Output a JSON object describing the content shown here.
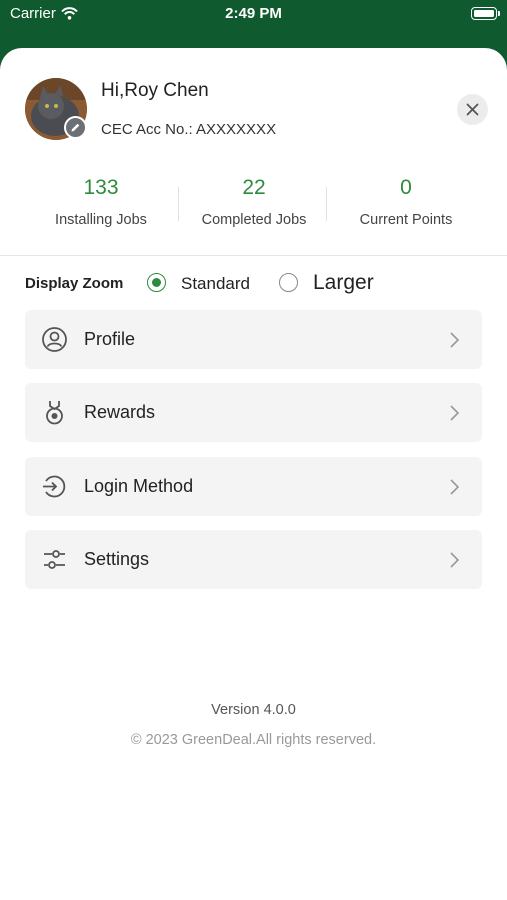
{
  "status_bar": {
    "carrier": "Carrier",
    "time": "2:49 PM"
  },
  "profile": {
    "greeting": "Hi,Roy Chen",
    "account": "CEC Acc No.: AXXXXXXX"
  },
  "stats": [
    {
      "value": "133",
      "label": "Installing Jobs"
    },
    {
      "value": "22",
      "label": "Completed Jobs"
    },
    {
      "value": "0",
      "label": "Current Points"
    }
  ],
  "display_zoom": {
    "label": "Display Zoom",
    "options": [
      "Standard",
      "Larger"
    ],
    "selected": "Standard"
  },
  "menu": [
    {
      "label": "Profile",
      "icon": "user-circle-icon"
    },
    {
      "label": "Rewards",
      "icon": "medal-icon"
    },
    {
      "label": "Login Method",
      "icon": "login-icon"
    },
    {
      "label": "Settings",
      "icon": "sliders-icon"
    }
  ],
  "footer": {
    "version": "Version 4.0.0",
    "copyright": "© 2023 GreenDeal.All rights reserved."
  },
  "colors": {
    "header_green": "#0f5a2e",
    "accent_green": "#2e8b3d"
  }
}
